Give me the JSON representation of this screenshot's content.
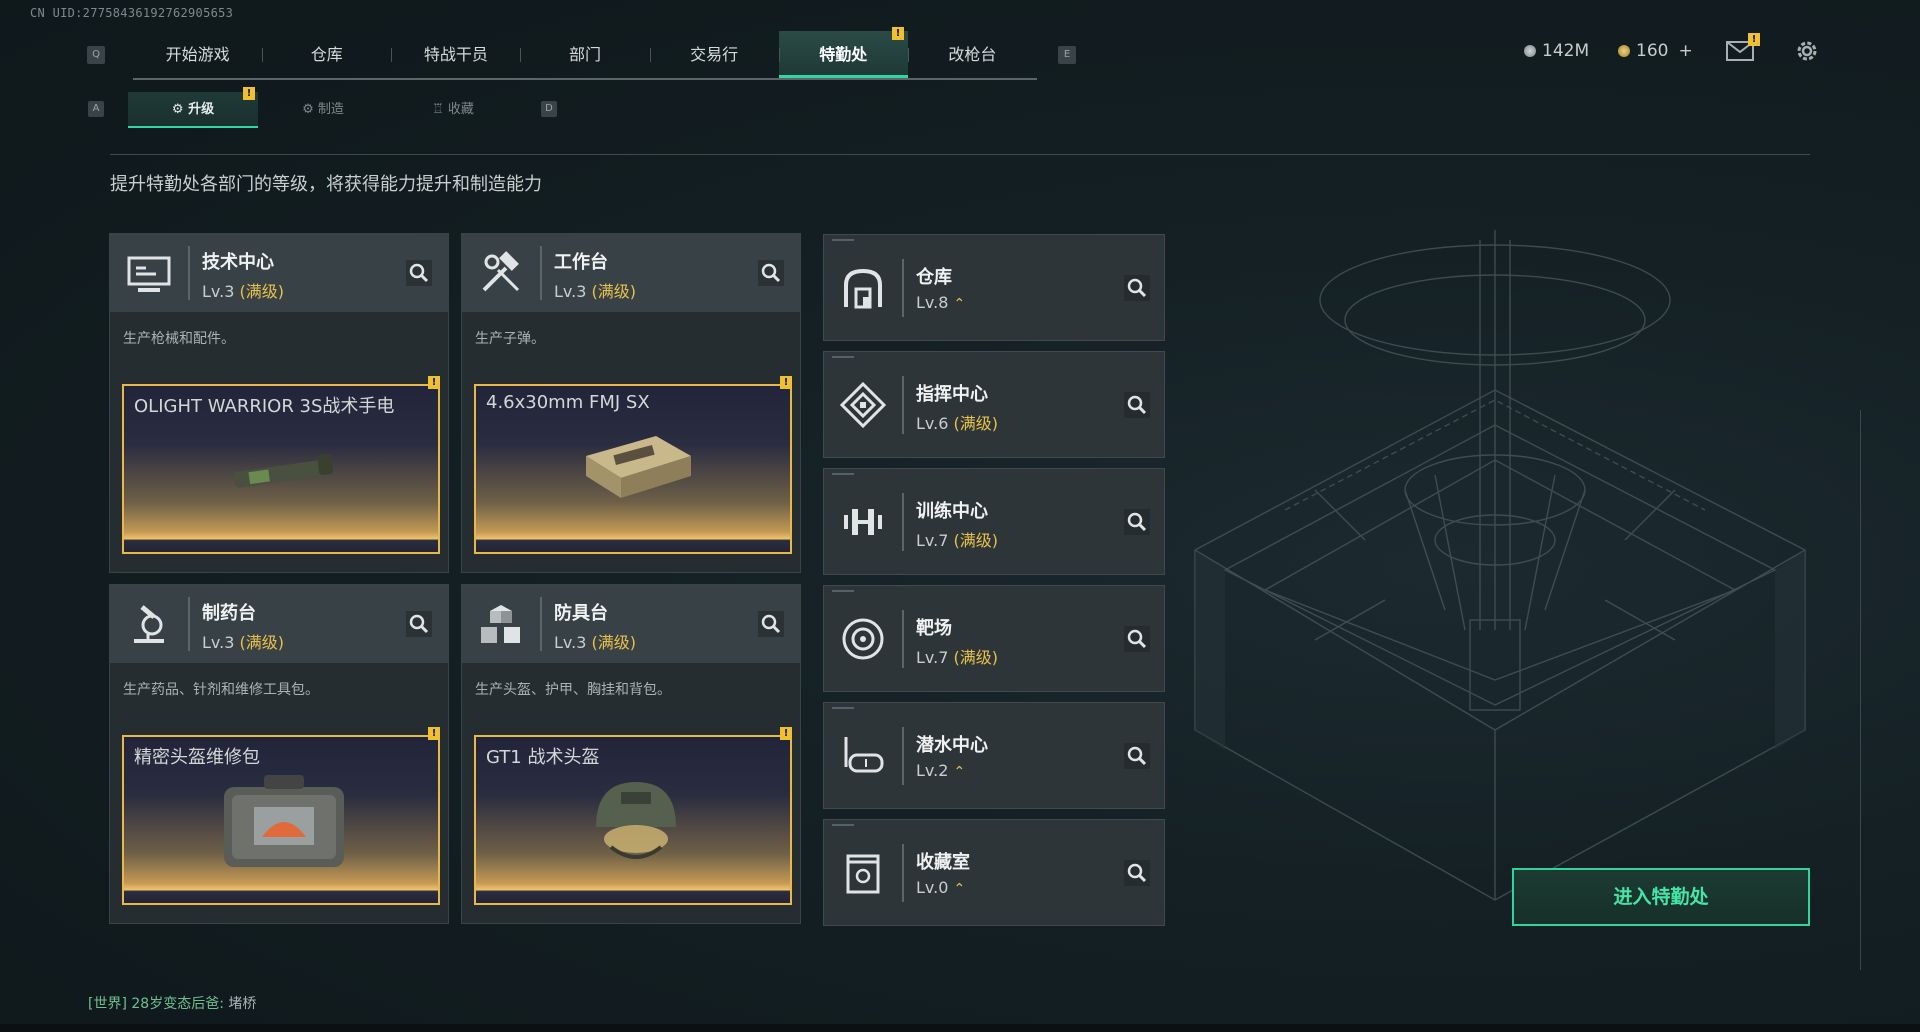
{
  "uid_label": "CN UID:27758436192762905653",
  "top_nav": {
    "key_left": "Q",
    "key_right": "E",
    "tabs": [
      {
        "label": "开始游戏",
        "active": false
      },
      {
        "label": "仓库",
        "active": false
      },
      {
        "label": "特战干员",
        "active": false
      },
      {
        "label": "部门",
        "active": false
      },
      {
        "label": "交易行",
        "active": false
      },
      {
        "label": "特勤处",
        "active": true
      },
      {
        "label": "改枪台",
        "active": false
      }
    ],
    "badge": "!"
  },
  "currencies": {
    "primary": "142M",
    "secondary": "160",
    "add_symbol": "+"
  },
  "icons": {
    "mail": "mail-icon",
    "settings": "gear-icon"
  },
  "sub_nav": {
    "key_left": "A",
    "key_right": "D",
    "tabs": [
      {
        "label": "升级",
        "active": true
      },
      {
        "label": "制造",
        "active": false
      },
      {
        "label": "收藏",
        "active": false
      }
    ]
  },
  "description": "提升特勤处各部门的等级，将获得能力提升和制造能力",
  "production_cards": [
    {
      "name": "技术中心",
      "level": "Lv.3",
      "max_label": "(满级)",
      "desc": "生产枪械和配件。",
      "item": "OLIGHT WARRIOR 3S战术手电",
      "icon": "computer-icon"
    },
    {
      "name": "工作台",
      "level": "Lv.3",
      "max_label": "(满级)",
      "desc": "生产子弹。",
      "item": "4.6x30mm FMJ SX",
      "icon": "hammer-wrench-icon"
    },
    {
      "name": "制药台",
      "level": "Lv.3",
      "max_label": "(满级)",
      "desc": "生产药品、针剂和维修工具包。",
      "item": "精密头盔维修包",
      "icon": "microscope-icon"
    },
    {
      "name": "防具台",
      "level": "Lv.3",
      "max_label": "(满级)",
      "desc": "生产头盔、护甲、胸挂和背包。",
      "item": "GT1 战术头盔",
      "icon": "cubes-icon"
    }
  ],
  "departments": [
    {
      "name": "仓库",
      "level": "Lv.8",
      "max_label": "",
      "upgrade": "⌃",
      "icon": "warehouse-icon"
    },
    {
      "name": "指挥中心",
      "level": "Lv.6",
      "max_label": "(满级)",
      "upgrade": "",
      "icon": "command-icon"
    },
    {
      "name": "训练中心",
      "level": "Lv.7",
      "max_label": "(满级)",
      "upgrade": "",
      "icon": "dumbbell-icon"
    },
    {
      "name": "靶场",
      "level": "Lv.7",
      "max_label": "(满级)",
      "upgrade": "",
      "icon": "target-icon"
    },
    {
      "name": "潜水中心",
      "level": "Lv.2",
      "max_label": "",
      "upgrade": "⌃",
      "icon": "diving-mask-icon"
    },
    {
      "name": "收藏室",
      "level": "Lv.0",
      "max_label": "",
      "upgrade": "⌃",
      "icon": "collection-icon"
    }
  ],
  "enter_button": "进入特勤处",
  "chat": {
    "channel": "[世界]",
    "sender": "28岁变态后爸:",
    "message": "堵桥"
  },
  "colors": {
    "accent_green": "#32d6a0",
    "gold": "#e8c14a",
    "badge_yellow": "#f0c030"
  }
}
